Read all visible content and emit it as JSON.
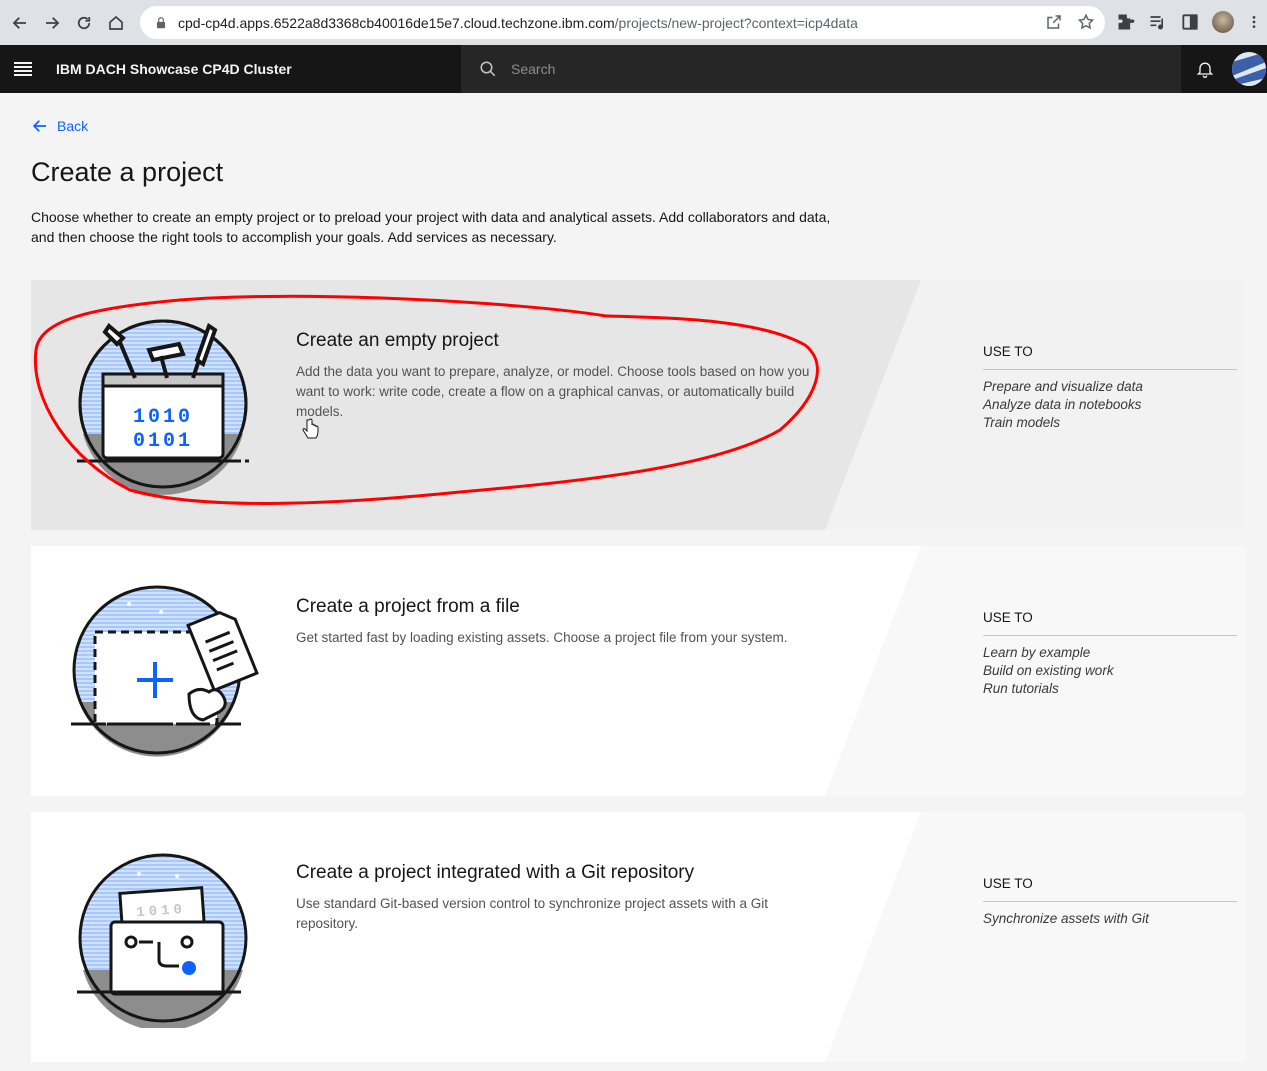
{
  "browser": {
    "url_host": "cpd-cp4d.apps.6522a8d3368cb40016de15e7.cloud.techzone.ibm.com",
    "url_path": "/projects/new-project?context=icp4data"
  },
  "header": {
    "product_title": "IBM DACH Showcase CP4D Cluster",
    "search_placeholder": "Search"
  },
  "page": {
    "back_label": "Back",
    "title": "Create a project",
    "description": "Choose whether to create an empty project or to preload your project with data and analytical assets. Add collaborators and data, and then choose the right tools to accomplish your goals. Add services as necessary."
  },
  "tiles": [
    {
      "title": "Create an empty project",
      "description": "Add the data you want to prepare, analyze, or model. Choose tools based on how you want to work: write code, create a flow on a graphical canvas, or automatically build models.",
      "use_heading": "USE TO",
      "uses": [
        "Prepare and visualize data",
        "Analyze data in notebooks",
        "Train models"
      ],
      "illus_line1": "1010",
      "illus_line2": "0101"
    },
    {
      "title": "Create a project from a file",
      "description": "Get started fast by loading existing assets. Choose a project file from your system.",
      "use_heading": "USE TO",
      "uses": [
        "Learn by example",
        "Build on existing work",
        "Run tutorials"
      ]
    },
    {
      "title": "Create a project integrated with a Git repository",
      "description": "Use standard Git-based version control to synchronize project assets with a Git repository.",
      "use_heading": "USE TO",
      "uses": [
        "Synchronize assets with Git"
      ],
      "illus_line1": "1010"
    }
  ],
  "colors": {
    "accent": "#0f62fe",
    "header_bg": "#161616",
    "annotation": "#ff0000"
  }
}
